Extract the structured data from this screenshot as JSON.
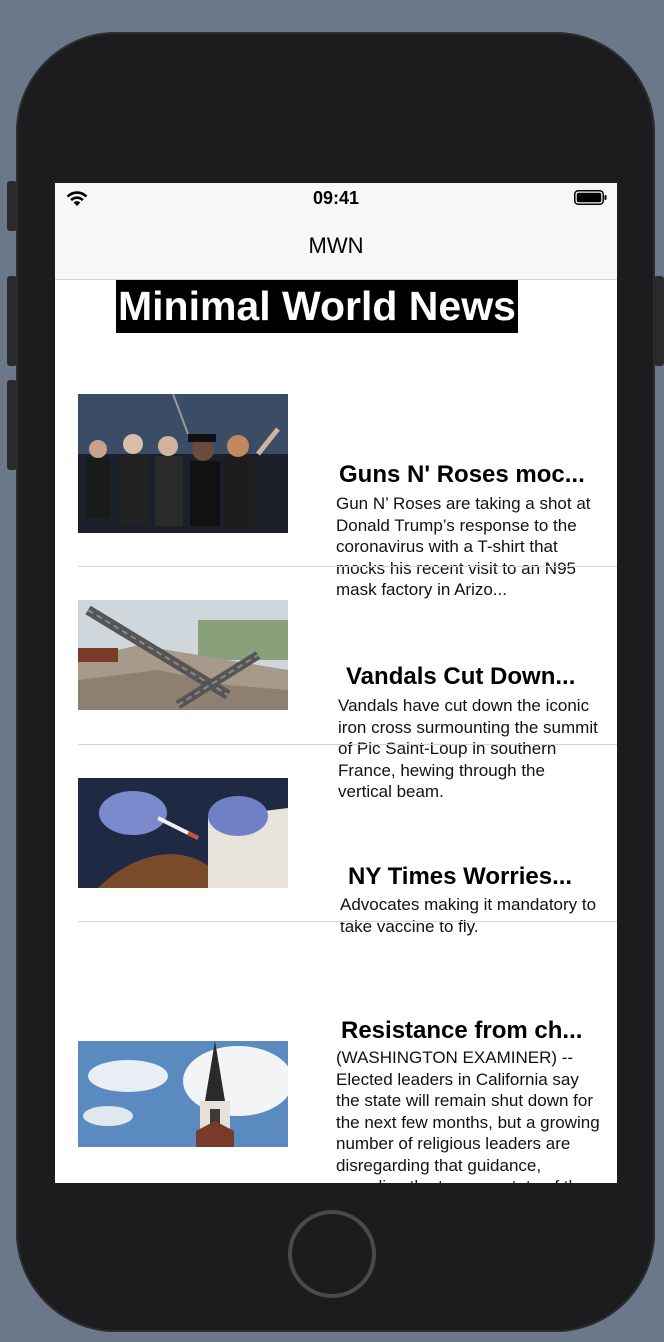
{
  "status_bar": {
    "time": "09:41",
    "icons": [
      "wifi-icon",
      "battery-icon"
    ]
  },
  "nav": {
    "title": "MWN"
  },
  "banner": {
    "title": "Minimal World News"
  },
  "articles": [
    {
      "headline": "Guns N' Roses moc...",
      "summary": "Gun N’ Roses are taking a shot at Donald Trump’s response to the coronavirus with a T-shirt that mocks his recent visit to an N95 mask factory in Arizo...",
      "image": "band-photo"
    },
    {
      "headline": "Vandals Cut Down...",
      "summary": "Vandals have cut down the iconic iron cross surmounting the summit of Pic Saint-Loup in southern France, hewing through the vertical beam.",
      "image": "fallen-cross-photo"
    },
    {
      "headline": "NY Times Worries...",
      "summary": "Advocates making it mandatory to take vaccine to fly.",
      "image": "vaccine-photo"
    },
    {
      "headline": "Resistance from ch...",
      "summary": "(WASHINGTON EXAMINER) -- Elected leaders in California say the state will remain shut down for the next few months, but a growing number of religious leaders are disregarding that guidance, revealing the tenuous state of the governments’ ability to enforce orders on unwilling people. California Church",
      "image": "church-steeple-photo"
    }
  ],
  "colors": {
    "background": "#6b7889",
    "device": "#1c1c1e",
    "bars": "#f7f7f7",
    "banner_bg": "#000000",
    "banner_text": "#ffffff"
  }
}
